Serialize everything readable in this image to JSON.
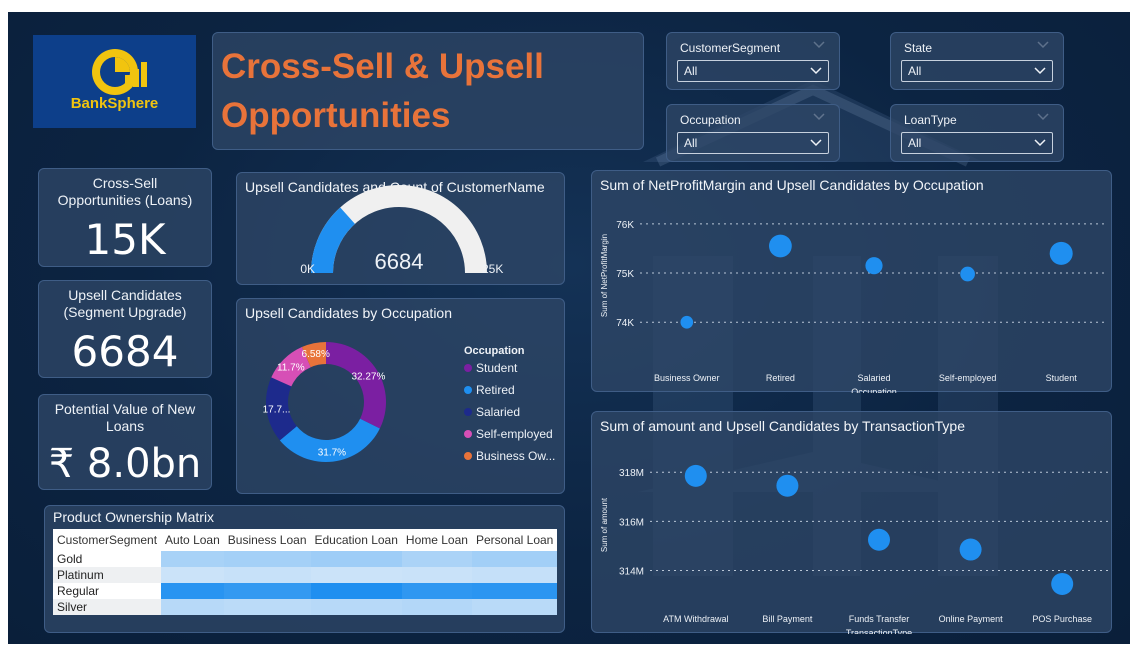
{
  "brand": {
    "name": "BankSphere"
  },
  "title": {
    "line1": "Cross-Sell & Upsell",
    "line2": "Opportunities"
  },
  "slicers": [
    {
      "label": "CustomerSegment",
      "value": "All"
    },
    {
      "label": "State",
      "value": "All"
    },
    {
      "label": "Occupation",
      "value": "All"
    },
    {
      "label": "LoanType",
      "value": "All"
    }
  ],
  "kpis": {
    "cross_sell": {
      "label_line1": "Cross-Sell",
      "label_line2": "Opportunities (Loans)",
      "value": "15K"
    },
    "upsell": {
      "label_line1": "Upsell Candidates",
      "label_line2": "(Segment Upgrade)",
      "value": "6684"
    },
    "potential": {
      "label_line1": "Potential Value of New",
      "label_line2": "Loans",
      "value": "₹ 8.0bn"
    }
  },
  "colors": {
    "accent_orange": "#e8733a",
    "point_blue": "#1f8ff0",
    "gauge_fill": "#1f8ff0",
    "gauge_track": "#f0f0f0"
  },
  "chart_data": [
    {
      "type": "gauge",
      "title": "Upsell Candidates and Count of CustomerName",
      "value": 6684,
      "value_label": "6684",
      "min": 0,
      "min_label": "0K",
      "max": 25000,
      "max_label": "25K"
    },
    {
      "type": "pie",
      "title": "Upsell Candidates by Occupation",
      "legend_title": "Occupation",
      "legend_position": "right",
      "slices": [
        {
          "name": "Student",
          "value": 32.27,
          "label": "32.27%",
          "color": "#7b1fa2"
        },
        {
          "name": "Retired",
          "value": 31.7,
          "label": "31.7%",
          "color": "#1f8ff0"
        },
        {
          "name": "Salaried",
          "value": 17.74,
          "label": "17.7...",
          "color": "#1d2a8c"
        },
        {
          "name": "Self-employed",
          "value": 11.7,
          "label": "11.7%",
          "color": "#d64fb6"
        },
        {
          "name": "Business Owner",
          "legend_label": "Business Ow...",
          "value": 6.58,
          "label": "6.58%",
          "color": "#e8733a"
        }
      ]
    },
    {
      "type": "scatter",
      "title": "Sum of NetProfitMargin and Upsell Candidates by Occupation",
      "xlabel": "Occupation",
      "ylabel": "Sum of NetProfitMargin",
      "categories": [
        "Business Owner",
        "Retired",
        "Salaried",
        "Self-employed",
        "Student"
      ],
      "values": [
        74000,
        75550,
        75150,
        74980,
        75400
      ],
      "sizes": [
        6.58,
        31.7,
        17.74,
        11.7,
        32.27
      ],
      "yticks": [
        74000,
        75000,
        76000
      ],
      "ytick_labels": [
        "74K",
        "75K",
        "76K"
      ],
      "ylim": [
        73700,
        76200
      ],
      "grid": true
    },
    {
      "type": "scatter",
      "title": "Sum of amount and Upsell Candidates by TransactionType",
      "xlabel": "TransactionType",
      "ylabel": "Sum of amount",
      "categories": [
        "ATM Withdrawal",
        "Bill Payment",
        "Funds Transfer",
        "Online Payment",
        "POS Purchase"
      ],
      "values": [
        317850000,
        317450000,
        315250000,
        314850000,
        313450000
      ],
      "yticks": [
        314000000,
        316000000,
        318000000
      ],
      "ytick_labels": [
        "314M",
        "316M",
        "318M"
      ],
      "ylim": [
        313000000,
        318700000
      ],
      "grid": true
    },
    {
      "type": "heatmap",
      "title": "Product Ownership Matrix",
      "row_header": "CustomerSegment",
      "columns": [
        "Auto Loan",
        "Business Loan",
        "Education Loan",
        "Home Loan",
        "Personal Loan"
      ],
      "rows": [
        "Gold",
        "Platinum",
        "Regular",
        "Silver"
      ],
      "values": [
        [
          0.3,
          0.32,
          0.35,
          0.28,
          0.33
        ],
        [
          0.12,
          0.14,
          0.12,
          0.13,
          0.15
        ],
        [
          0.95,
          0.9,
          1.0,
          0.92,
          0.94
        ],
        [
          0.22,
          0.2,
          0.22,
          0.24,
          0.21
        ]
      ]
    }
  ]
}
